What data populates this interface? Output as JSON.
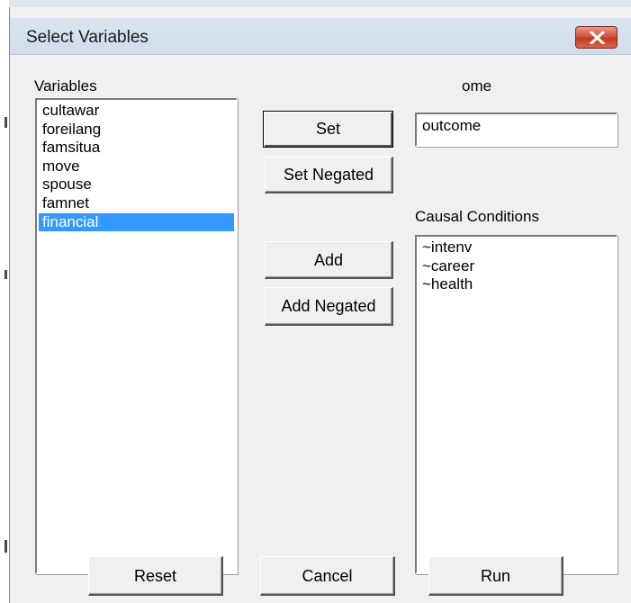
{
  "window": {
    "title": "Select Variables",
    "close_icon": "close-x-icon"
  },
  "variables": {
    "label": "Variables",
    "items": [
      "cultawar",
      "foreilang",
      "famsitua",
      "move",
      "spouse",
      "famnet",
      "financial"
    ],
    "selected": "financial"
  },
  "outcome": {
    "label": "ome",
    "value": "outcome"
  },
  "buttons": {
    "set": "Set",
    "set_negated": "Set Negated",
    "add": "Add",
    "add_negated": "Add Negated",
    "reset": "Reset",
    "cancel": "Cancel",
    "run": "Run"
  },
  "causal": {
    "label": "Causal Conditions",
    "items": [
      "~intenv",
      "~career",
      "~health"
    ]
  },
  "colors": {
    "selection": "#3399ff",
    "close_button": "#c9452c",
    "dialog_bg": "#f0f0f0"
  }
}
